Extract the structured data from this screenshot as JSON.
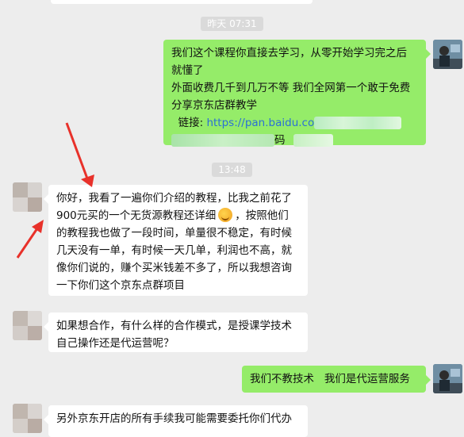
{
  "timestamps": [
    "昨天 07:31",
    "13:48"
  ],
  "messages": {
    "m1": {
      "lines": [
        "我们这个课程你直接去学习，从零开始学习完之后",
        "就懂了",
        "外面收费几千到几万不等 我们全网第一个敢于免费",
        "分享京东店群教学"
      ],
      "link_label": "链接:",
      "link_url": "https://pan.baidu.co",
      "line6_tail": "码"
    },
    "m2": {
      "lines": [
        "你好，我看了一遍你们介绍的教程，比我之前花了",
        "900元买的一个无货源教程还详细",
        "，按照他们",
        "的教程我也做了一段时间，单量很不稳定，有时候",
        "几天没有一单，有时候一天几单，利润也不高，就",
        "像你们说的，赚个买米钱差不多了，所以我想咨询",
        "一下你们这个京东点群项目"
      ],
      "emoji": "laughing-tears-emoji"
    },
    "m3": {
      "lines": [
        "如果想合作，有什么样的合作模式，是授课学技术",
        "自己操作还是代运营呢？"
      ]
    },
    "m4": {
      "text": "我们不教技术   我们是代运营服务"
    },
    "m5": {
      "text": "另外京东开店的所有手续我可能需要委托你们代办"
    }
  },
  "colors": {
    "background": "#ededed",
    "my_bubble": "#95ec69",
    "their_bubble": "#ffffff",
    "link": "#2a6fd6",
    "annotation_arrow": "#e8312a"
  }
}
